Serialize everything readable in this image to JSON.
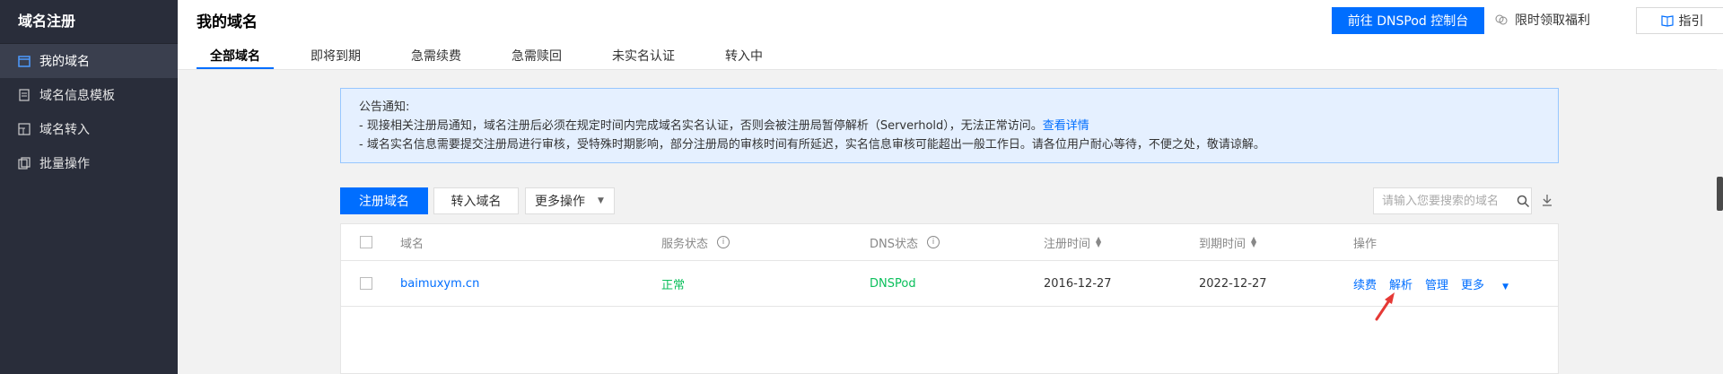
{
  "sidebar": {
    "title": "域名注册",
    "items": [
      {
        "label": "我的域名",
        "active": true
      },
      {
        "label": "域名信息模板",
        "active": false
      },
      {
        "label": "域名转入",
        "active": false
      },
      {
        "label": "批量操作",
        "active": false
      }
    ]
  },
  "header": {
    "title": "我的域名",
    "tabs": [
      "全部域名",
      "即将到期",
      "急需续费",
      "急需赎回",
      "未实名认证",
      "转入中"
    ],
    "console_button": "前往 DNSPod 控制台",
    "welfare_label": "限时领取福利",
    "guide_label": "指引"
  },
  "notice": {
    "title": "公告通知:",
    "line1": "- 现接相关注册局通知，域名注册后必须在规定时间内完成域名实名认证，否则会被注册局暂停解析（Serverhold），无法正常访问。",
    "line1_link": "查看详情",
    "line2": "- 域名实名信息需要提交注册局进行审核，受特殊时期影响，部分注册局的审核时间有所延迟，实名信息审核可能超出一般工作日。请各位用户耐心等待，不便之处，敬请谅解。"
  },
  "toolbar": {
    "register_button": "注册域名",
    "transfer_button": "转入域名",
    "more_button": "更多操作",
    "search_placeholder": "请输入您要搜索的域名"
  },
  "table": {
    "headers": {
      "domain": "域名",
      "service_status": "服务状态",
      "dns_status": "DNS状态",
      "register_time": "注册时间",
      "expire_time": "到期时间",
      "actions": "操作"
    },
    "rows": [
      {
        "domain": "baimuxym.cn",
        "service_status": "正常",
        "dns_status": "DNSPod",
        "register_time": "2016-12-27",
        "expire_time": "2022-12-27",
        "actions": [
          "续费",
          "解析",
          "管理",
          "更多"
        ]
      }
    ]
  },
  "colors": {
    "primary": "#006eff",
    "sidebar_bg": "#292d3a",
    "status_ok": "#0abf5b",
    "annotation_arrow": "#e53935"
  }
}
